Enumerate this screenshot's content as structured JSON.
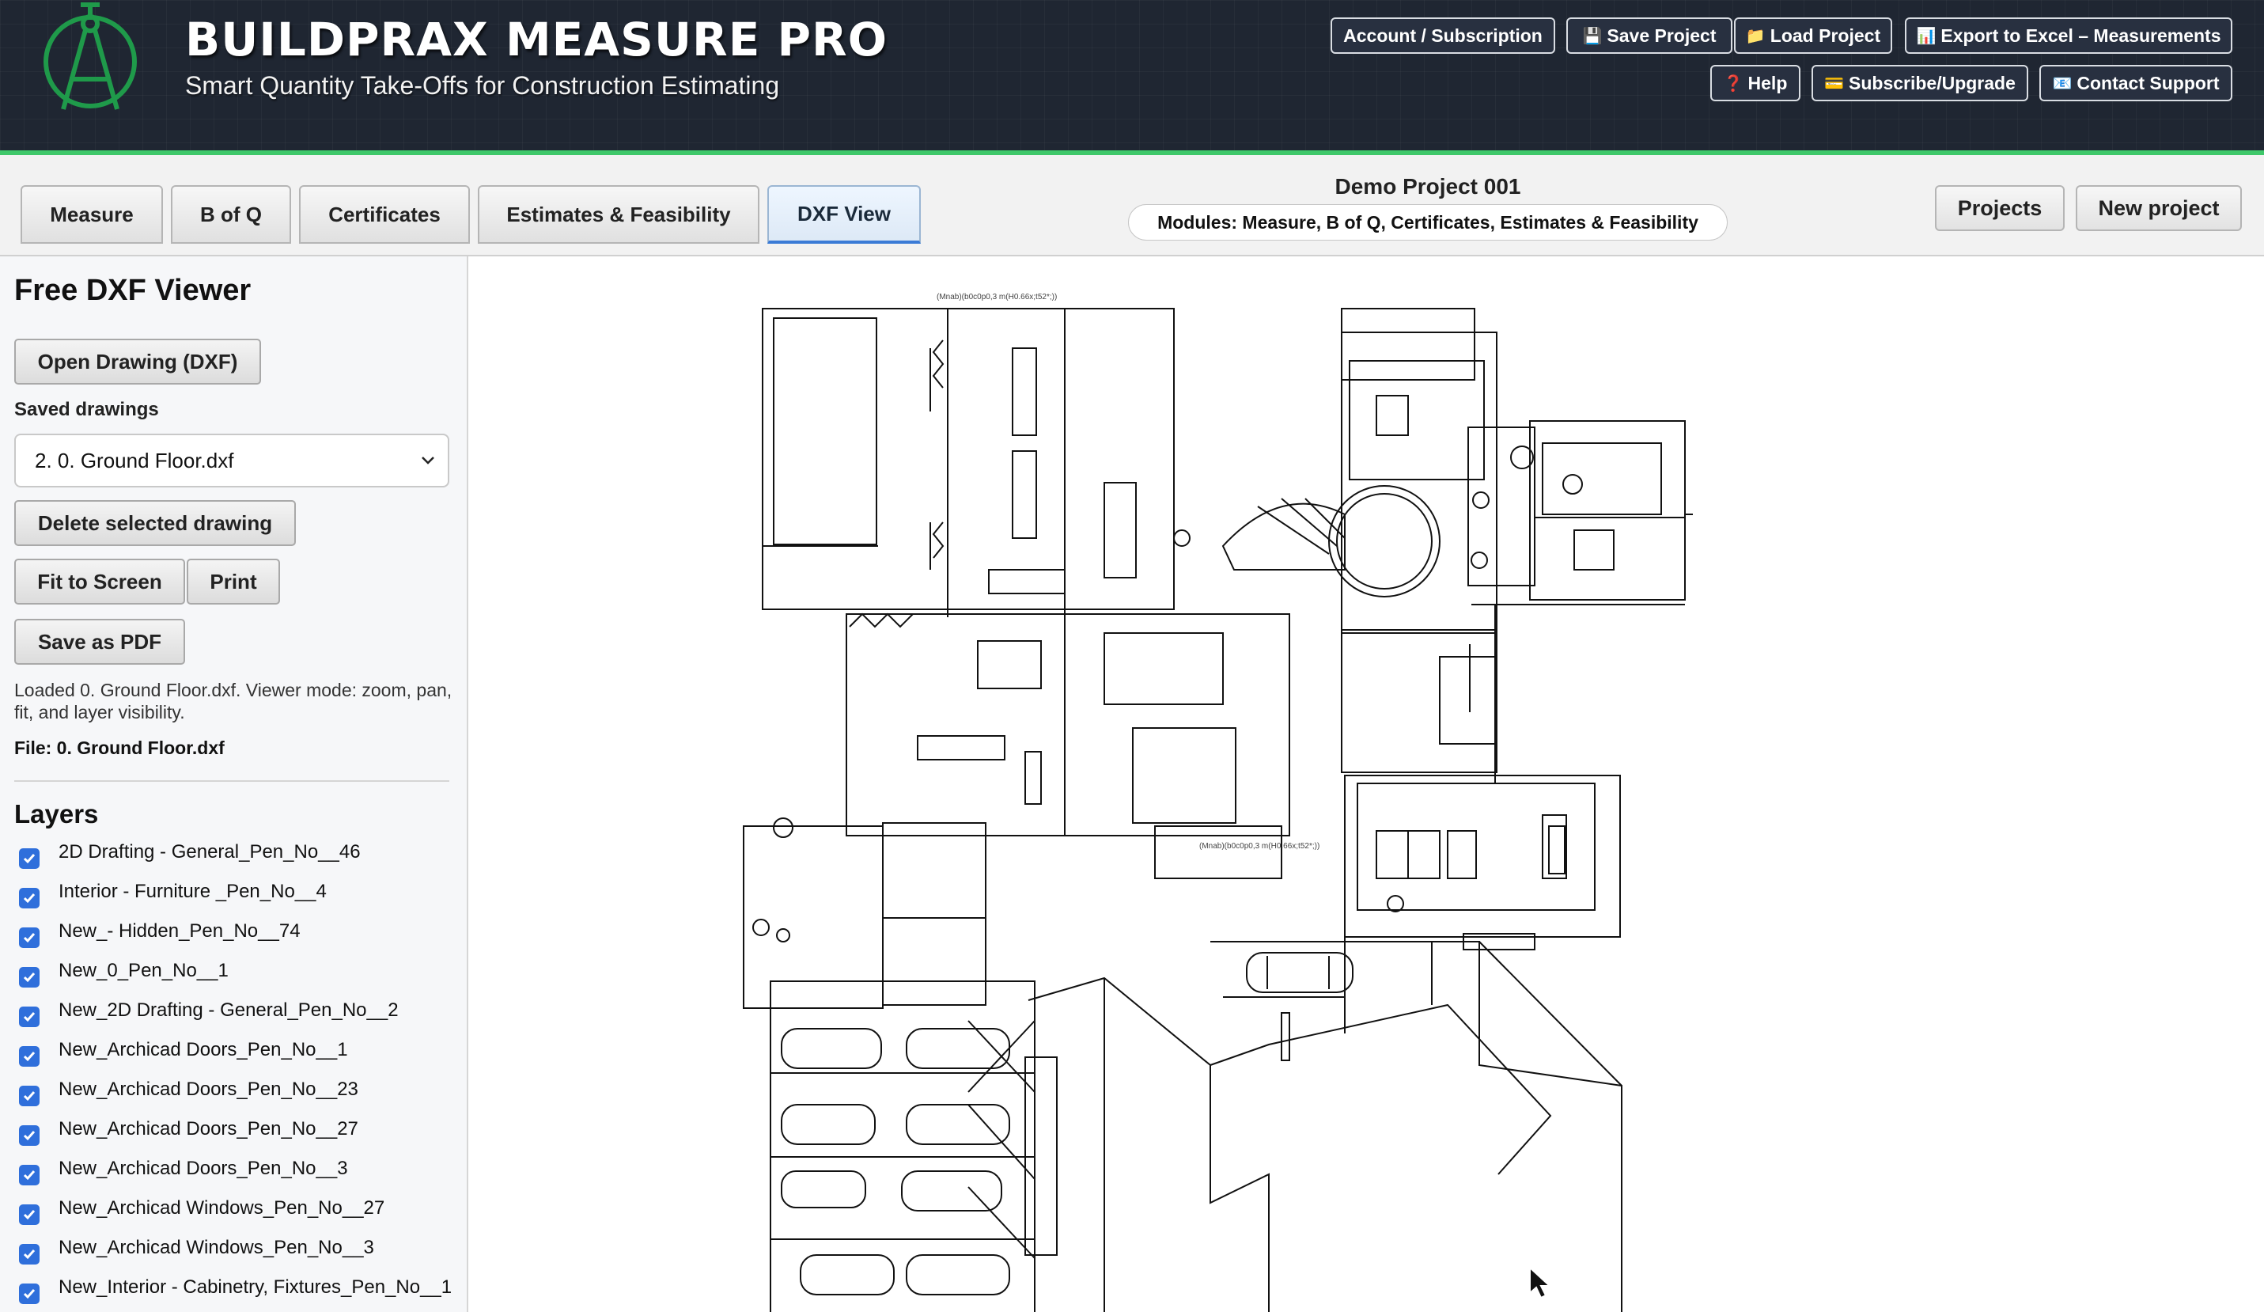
{
  "header": {
    "title": "BUILDPRAX MEASURE PRO",
    "subtitle": "Smart Quantity Take-Offs for Construction Estimating",
    "buttons": {
      "account": "Account / Subscription",
      "save_project": "Save Project",
      "load_project": "Load Project",
      "export_excel": "Export to Excel – Measurements",
      "help": "Help",
      "subscribe": "Subscribe/Upgrade",
      "contact": "Contact Support"
    },
    "icons": {
      "save_project": "💾",
      "load_project": "📁",
      "export_excel": "📊",
      "help": "❓",
      "subscribe": "💳",
      "contact": "📧"
    }
  },
  "tabs": {
    "measure": "Measure",
    "boq": "B of Q",
    "certificates": "Certificates",
    "estimates": "Estimates & Feasibility",
    "dxf": "DXF View",
    "active": "DXF View"
  },
  "project": {
    "name": "Demo Project 001",
    "modules": "Modules: Measure, B of Q, Certificates, Estimates & Feasibility"
  },
  "top_right": {
    "projects": "Projects",
    "new_project": "New project"
  },
  "sidebar": {
    "title": "Free DXF Viewer",
    "open_drawing": "Open Drawing (DXF)",
    "saved_label": "Saved drawings",
    "selected_drawing": "2. 0. Ground Floor.dxf",
    "delete": "Delete selected drawing",
    "fit": "Fit to Screen",
    "print": "Print",
    "save_pdf": "Save as PDF",
    "status": "Loaded 0. Ground Floor.dxf. Viewer mode: zoom, pan, fit, and layer visibility.",
    "file": "File: 0. Ground Floor.dxf",
    "layers_title": "Layers",
    "layers": [
      {
        "label": "2D Drafting - General_Pen_No__46",
        "checked": true
      },
      {
        "label": "Interior - Furniture _Pen_No__4",
        "checked": true
      },
      {
        "label": "New_- Hidden_Pen_No__74",
        "checked": true
      },
      {
        "label": "New_0_Pen_No__1",
        "checked": true
      },
      {
        "label": "New_2D Drafting - General_Pen_No__2",
        "checked": true
      },
      {
        "label": "New_Archicad Doors_Pen_No__1",
        "checked": true
      },
      {
        "label": "New_Archicad Doors_Pen_No__23",
        "checked": true
      },
      {
        "label": "New_Archicad Doors_Pen_No__27",
        "checked": true
      },
      {
        "label": "New_Archicad Doors_Pen_No__3",
        "checked": true
      },
      {
        "label": "New_Archicad Windows_Pen_No__27",
        "checked": true
      },
      {
        "label": "New_Archicad Windows_Pen_No__3",
        "checked": true
      },
      {
        "label": "New_Interior - Cabinetry, Fixtures_Pen_No__1",
        "checked": true
      }
    ]
  },
  "drawing": {
    "annotation_1": "(Mnab)(b0c0p0,3 m(H0.66x;t52*;))",
    "annotation_2": "(Mnab)(b0c0p0,3 m(H0.66x;t52*;))"
  }
}
